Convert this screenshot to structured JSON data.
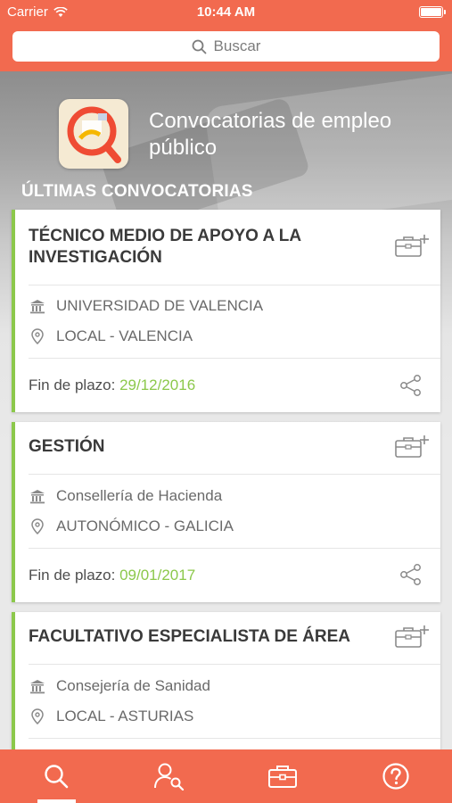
{
  "status_bar": {
    "carrier": "Carrier",
    "time": "10:44 AM"
  },
  "search": {
    "placeholder": "Buscar"
  },
  "header": {
    "app_title": "Convocatorias de empleo público",
    "section_title": "ÚLTIMAS CONVOCATORIAS"
  },
  "listings": [
    {
      "title": "TÉCNICO MEDIO DE APOYO A LA INVESTIGACIÓN",
      "institution": "UNIVERSIDAD DE VALENCIA",
      "location": "LOCAL - VALENCIA",
      "deadline_label": "Fin de plazo:",
      "deadline_date": "29/12/2016"
    },
    {
      "title": "GESTIÓN",
      "institution": "Consellería de Hacienda",
      "location": "AUTONÓMICO - GALICIA",
      "deadline_label": "Fin de plazo:",
      "deadline_date": "09/01/2017"
    },
    {
      "title": "FACULTATIVO ESPECIALISTA DE ÁREA",
      "institution": "Consejería de Sanidad",
      "location": "LOCAL - ASTURIAS"
    }
  ],
  "tab_bar": {
    "active_tab": "search",
    "tabs": [
      "search",
      "profile-search",
      "briefcase",
      "help"
    ]
  },
  "colors": {
    "brand": "#f26a4f",
    "accent": "#8cc84b"
  },
  "icons": [
    "wifi-icon",
    "battery-icon",
    "search-icon",
    "building-icon",
    "location-pin-icon",
    "add-briefcase-icon",
    "share-icon",
    "user-search-icon",
    "briefcase-icon",
    "help-icon"
  ]
}
